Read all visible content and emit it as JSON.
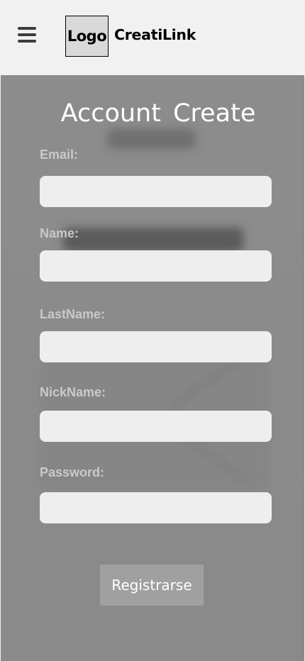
{
  "header": {
    "logo_text": "Logo",
    "brand_name": "CreatiLink",
    "menu_icon": "hamburger-menu-icon"
  },
  "form": {
    "title": "Account  Create",
    "fields": [
      {
        "label": "Email:",
        "value": "",
        "placeholder": ""
      },
      {
        "label": "Name:",
        "value": "",
        "placeholder": ""
      },
      {
        "label": "LastName:",
        "value": "",
        "placeholder": ""
      },
      {
        "label": "NickName:",
        "value": "",
        "placeholder": ""
      },
      {
        "label": "Password:",
        "value": "",
        "placeholder": ""
      }
    ],
    "submit_label": "Registrarse"
  },
  "colors": {
    "header_bg": "#f1f1f1",
    "form_bg": "#8c8c8c",
    "input_bg": "#eeeeee",
    "button_bg": "#a0a0a0",
    "label_text": "#c9c9c9"
  }
}
